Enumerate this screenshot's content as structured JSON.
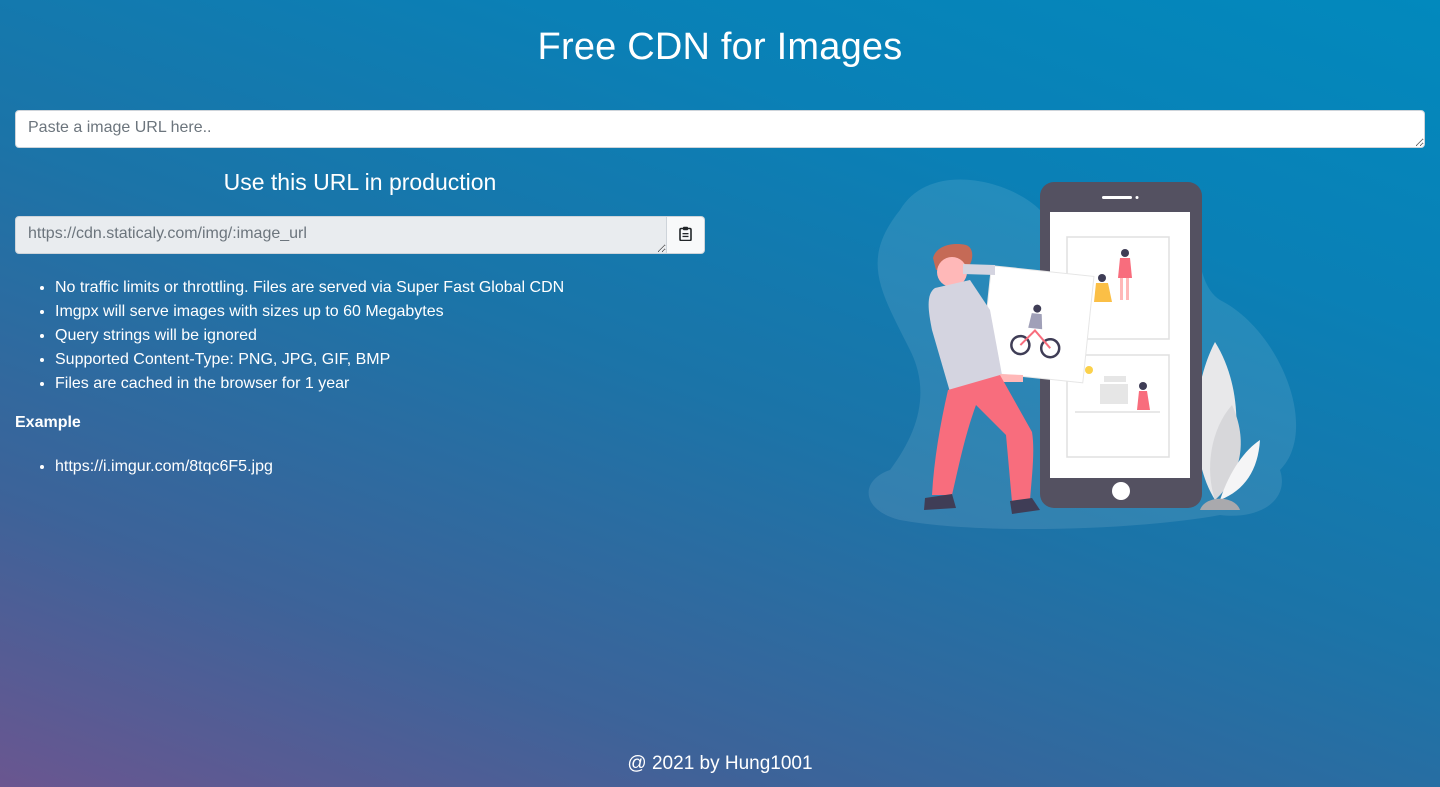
{
  "header": {
    "title": "Free CDN for Images"
  },
  "input": {
    "placeholder": "Paste a image URL here.."
  },
  "production": {
    "title": "Use this URL in production",
    "url_placeholder": "https://cdn.staticaly.com/img/:image_url",
    "copy_icon": "clipboard-icon"
  },
  "features": [
    "No traffic limits or throttling. Files are served via Super Fast Global CDN",
    "Imgpx will serve images with sizes up to 60 Megabytes",
    "Query strings will be ignored",
    "Supported Content-Type: PNG, JPG, GIF, BMP",
    "Files are cached in the browser for 1 year"
  ],
  "example": {
    "label": "Example",
    "items": [
      "https://i.imgur.com/8tqc6F5.jpg"
    ]
  },
  "footer": {
    "text": "@ 2021 by Hung1001"
  },
  "colors": {
    "gradient_top_right": "#0289bd",
    "gradient_bottom_left": "#6a5690",
    "accent_pink": "#f86d7d",
    "phone_dark": "#545161"
  }
}
